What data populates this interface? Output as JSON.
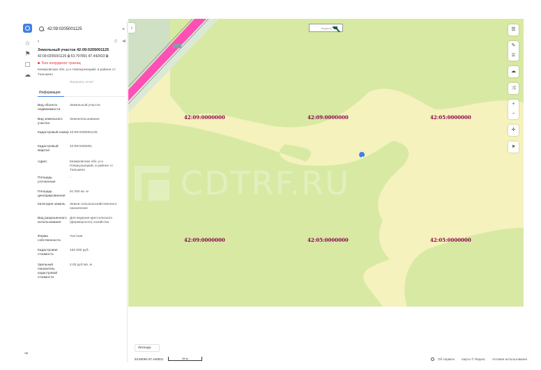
{
  "sidebar": {
    "exit_glyph": "⇥"
  },
  "panel": {
    "search_value": "42:09:0205001125",
    "close_glyph": "×",
    "back_glyph": "‹",
    "star_glyph": "☆",
    "share_glyph": "⋖",
    "title": "Земельный участок 42:09:0205001125",
    "cadastral_line": "42:09:0205001125 ⧉   53.797891 87.442433 ⧉",
    "warning": "Без координат границ",
    "address_short": "Кемеровская обл, р-н Новокузнецкий, в районе ст. Тальжино",
    "request_label": "Получить отчет",
    "tab_info": "Информация",
    "rows": [
      {
        "label": "Вид объекта недвижимости",
        "value": "Земельный участок"
      },
      {
        "label": "Вид земельного участка",
        "value": "Землепользование"
      },
      {
        "label": "Кадастровый номер",
        "value": "42:09:0205001125"
      },
      {
        "label": "Кадастровый квартал",
        "value": "42:09:0205001"
      },
      {
        "label": "Адрес",
        "value": "Кемеровская обл, р-н Новокузнецкий, в районе ст. Тальжино"
      },
      {
        "label": "Площадь уточненная",
        "value": "-"
      },
      {
        "label": "Площадь декларированная",
        "value": "91 000 кв. м"
      },
      {
        "label": "Категория земель",
        "value": "Земли сельскохозяйственного назначения"
      },
      {
        "label": "Вид разрешенного использования",
        "value": "Для ведения крестьянского (фермерского) хозяйства"
      },
      {
        "label": "Форма собственности",
        "value": "Частная"
      },
      {
        "label": "Кадастровая стоимость",
        "value": "182 000 руб."
      },
      {
        "label": "Удельный показатель кадастровой стоимости",
        "value": "2,00 руб./кв. м"
      }
    ]
  },
  "map": {
    "collapse_glyph": "‹",
    "placard_text": "Кадастр",
    "parcel_labels": [
      "42:09:0000000",
      "42:09:0000000",
      "42:05:0000000",
      "42:09:0000000",
      "42:05:0000000",
      "42:05:0000000"
    ],
    "watermark": "CDTRF.RU",
    "controls": {
      "layers": "☰",
      "edit": "✎",
      "ruler": "⌸",
      "cloud": "☁",
      "route": "⤨",
      "zoom_in": "+",
      "zoom_out": "−",
      "compass": "✛",
      "locate": "➤"
    },
    "colors": {
      "land": "#f5f2bd",
      "field": "#d8e9a4",
      "road": "#ff4fb6",
      "marker": "#3f7fe6",
      "label": "#8b004d"
    }
  },
  "footer": {
    "legend": "Легенда",
    "coords": "53.80094  87.440831",
    "scale": "50 м",
    "about": "Об сервисе",
    "maps": "Карты © Яндекс",
    "terms": "Условия использования"
  }
}
